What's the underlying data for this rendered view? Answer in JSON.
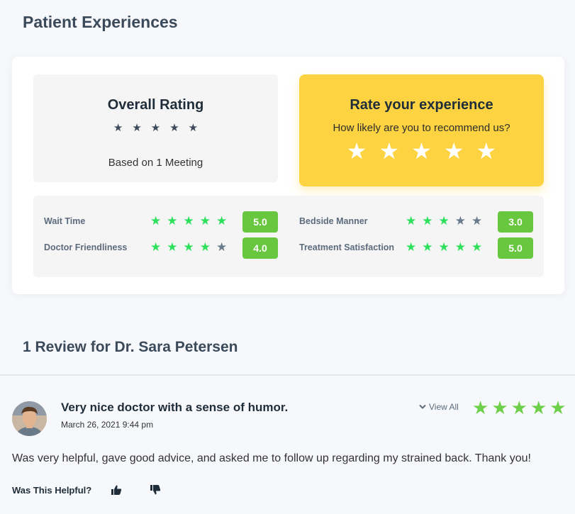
{
  "page": {
    "title": "Patient Experiences"
  },
  "overall": {
    "title": "Overall Rating",
    "stars": 5,
    "subtitle": "Based on 1 Meeting"
  },
  "rate": {
    "title": "Rate your experience",
    "subtitle": "How likely are you to recommend us?",
    "stars": 5
  },
  "metrics": [
    {
      "label": "Wait Time",
      "stars_filled": 5,
      "score": "5.0"
    },
    {
      "label": "Doctor Friendliness",
      "stars_filled": 4,
      "score": "4.0"
    },
    {
      "label": "Bedside Manner",
      "stars_filled": 3,
      "score": "3.0"
    },
    {
      "label": "Treatment Satisfaction",
      "stars_filled": 5,
      "score": "5.0"
    }
  ],
  "reviews_section": {
    "title": "1 Review for Dr. Sara Petersen"
  },
  "review": {
    "title": "Very nice doctor with a sense of humor.",
    "date": "March 26, 2021 9:44 pm",
    "view_all": "View All",
    "stars": 5,
    "body": "Was very helpful, gave good advice, and asked me to follow up regarding my strained back. Thank you!",
    "helpful_label": "Was This Helpful?"
  },
  "colors": {
    "star_green": "#2ee05c",
    "star_grey": "#6b7b8e",
    "badge_green": "#68c63f",
    "rate_yellow": "#fdd341",
    "review_star_green": "#6ed04a"
  },
  "icons": {
    "thumbs_up": "thumbs-up-icon",
    "thumbs_down": "thumbs-down-icon",
    "chevron": "chevron-down-icon"
  }
}
